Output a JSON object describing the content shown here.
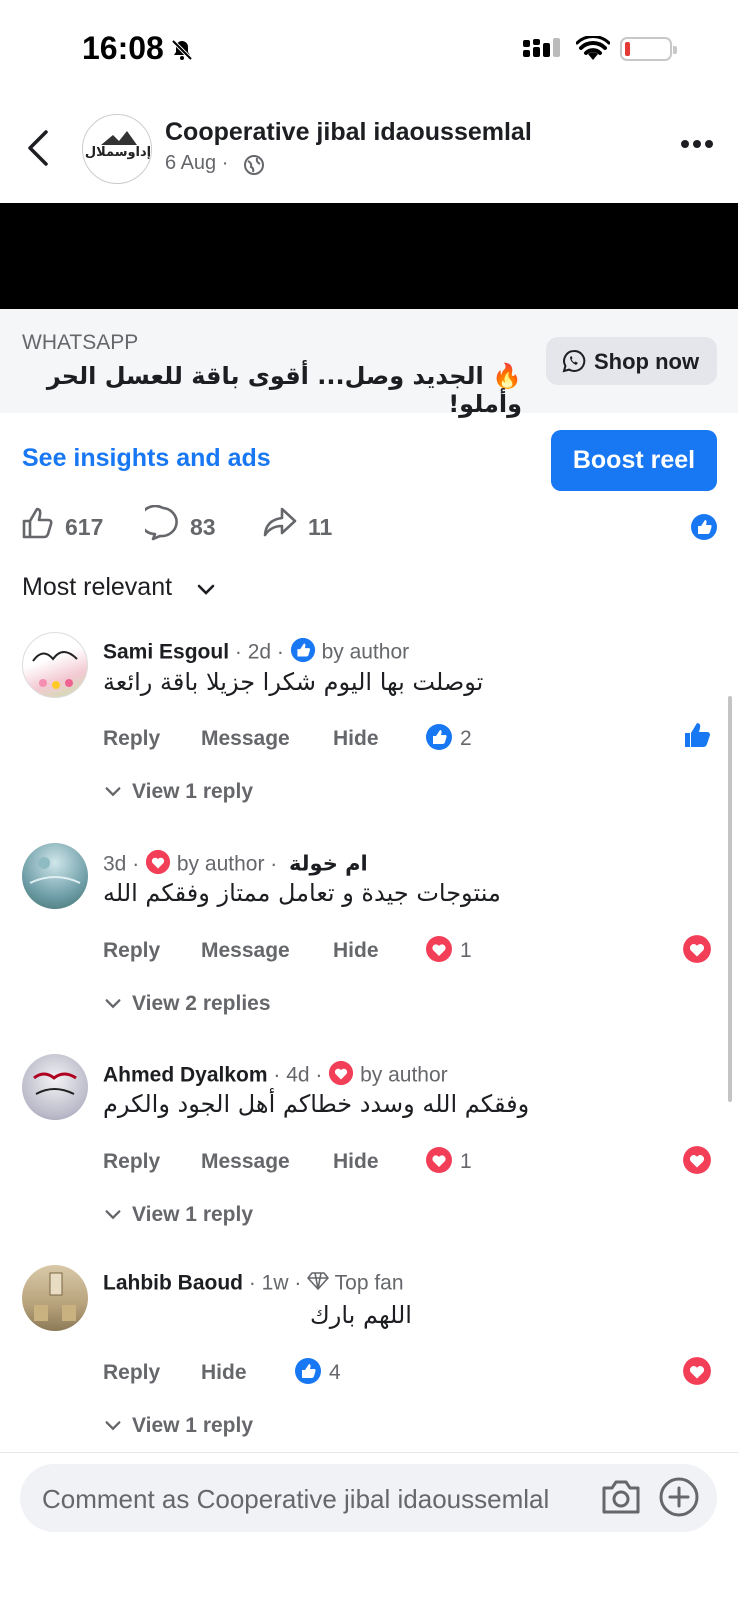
{
  "status_bar": {
    "time": "16:08"
  },
  "post": {
    "page_name": "Cooperative jibal idaoussemlal",
    "logo_text": "إداوسملال",
    "date": "6 Aug ·"
  },
  "ad": {
    "source": "WHATSAPP",
    "headline": "🔥 الجديد وصل... أقوى باقة للعسل الحر وأملو!",
    "cta": "Shop now"
  },
  "insights": {
    "link": "See insights and ads",
    "boost": "Boost reel"
  },
  "counts": {
    "likes": "617",
    "comments": "83",
    "shares": "11"
  },
  "sort": {
    "label": "Most relevant"
  },
  "comments": [
    {
      "name": "Sami Esgoul",
      "meta": " · 2d · ",
      "badge": "by author",
      "text": "توصلت بها اليوم شكرا جزيلا باقة رائعة",
      "actions": [
        "Reply",
        "Message",
        "Hide"
      ],
      "reaction_count": "2",
      "view_replies": "View 1 reply"
    },
    {
      "name": "ام خولة",
      "meta": "3d · ",
      "badge": "by author ·",
      "text": "منتوجات جيدة و تعامل ممتاز وفقكم الله",
      "actions": [
        "Reply",
        "Message",
        "Hide"
      ],
      "reaction_count": "1",
      "view_replies": "View 2 replies"
    },
    {
      "name": "Ahmed Dyalkom",
      "meta": " · 4d · ",
      "badge": "by author",
      "text": "وفقكم الله وسدد خطاكم أهل الجود والكرم",
      "actions": [
        "Reply",
        "Message",
        "Hide"
      ],
      "reaction_count": "1",
      "view_replies": "View 1 reply"
    },
    {
      "name": "Lahbib Baoud",
      "meta": " · 1w · ",
      "badge": "Top fan",
      "text": "اللهم بارك",
      "actions": [
        "Reply",
        "Hide"
      ],
      "reaction_count": "4",
      "view_replies": "View 1 reply"
    }
  ],
  "composer": {
    "placeholder": "Comment as Cooperative jibal idaoussemlal"
  },
  "colors": {
    "accent": "#1877f2",
    "love": "#f33e58",
    "muted": "#65676b"
  }
}
